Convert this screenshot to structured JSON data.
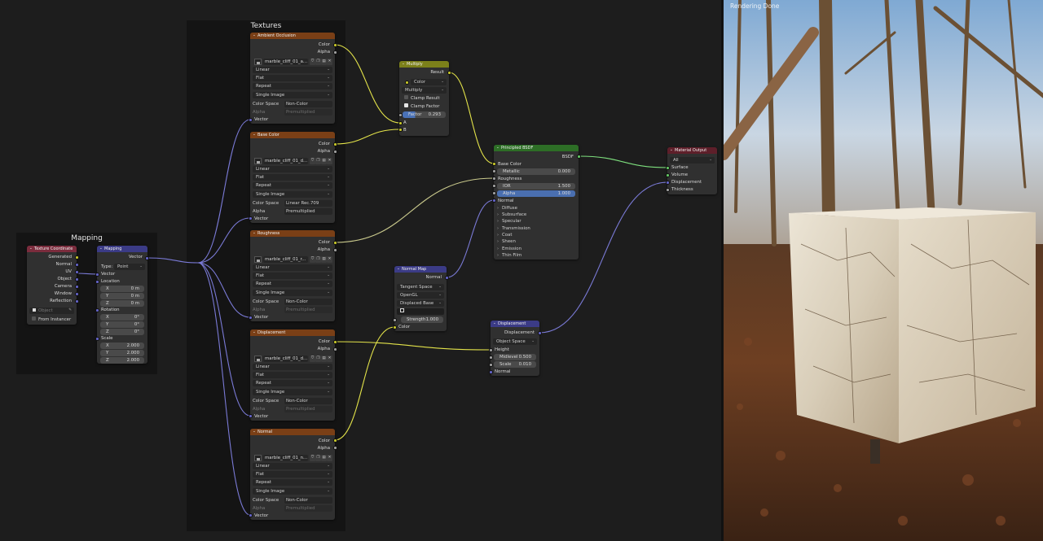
{
  "frames": {
    "textures": "Textures",
    "mapping": "Mapping"
  },
  "tex_coord": {
    "title": "Texture Coordinate",
    "outputs": [
      "Generated",
      "Normal",
      "UV",
      "Object",
      "Camera",
      "Window",
      "Reflection"
    ],
    "object_placeholder": "Object",
    "from_instancer": "From Instancer"
  },
  "mapping": {
    "title": "Mapping",
    "output": "Vector",
    "type_label": "Type:",
    "type_value": "Point",
    "vector": "Vector",
    "location": {
      "label": "Location",
      "x": "0 m",
      "y": "0 m",
      "z": "0 m"
    },
    "rotation": {
      "label": "Rotation",
      "x": "0°",
      "y": "0°",
      "z": "0°"
    },
    "scale": {
      "label": "Scale",
      "x": "2.000",
      "y": "2.000",
      "z": "2.000"
    },
    "axes": [
      "X",
      "Y",
      "Z"
    ]
  },
  "textures": [
    {
      "title": "Ambient Occlusion",
      "file": "marble_cliff_01_a...",
      "interp": "Linear",
      "proj": "Flat",
      "ext": "Repeat",
      "source": "Single Image",
      "cs_label": "Color Space",
      "cs_value": "Non-Color",
      "alpha_label": "Alpha",
      "alpha_value": "Premultiplied",
      "alpha_dim": true
    },
    {
      "title": "Base Color",
      "file": "marble_cliff_01_d...",
      "interp": "Linear",
      "proj": "Flat",
      "ext": "Repeat",
      "source": "Single Image",
      "cs_label": "Color Space",
      "cs_value": "Linear Rec.709",
      "alpha_label": "Alpha",
      "alpha_value": "Premultiplied",
      "alpha_dim": false
    },
    {
      "title": "Roughness",
      "file": "marble_cliff_01_r...",
      "interp": "Linear",
      "proj": "Flat",
      "ext": "Repeat",
      "source": "Single Image",
      "cs_label": "Color Space",
      "cs_value": "Non-Color",
      "alpha_label": "Alpha",
      "alpha_value": "Premultiplied",
      "alpha_dim": true
    },
    {
      "title": "Displacement",
      "file": "marble_cliff_01_d...",
      "interp": "Linear",
      "proj": "Flat",
      "ext": "Repeat",
      "source": "Single Image",
      "cs_label": "Color Space",
      "cs_value": "Non-Color",
      "alpha_label": "Alpha",
      "alpha_value": "Premultiplied",
      "alpha_dim": true
    },
    {
      "title": "Normal",
      "file": "marble_cliff_01_n...",
      "interp": "Linear",
      "proj": "Flat",
      "ext": "Repeat",
      "source": "Single Image",
      "cs_label": "Color Space",
      "cs_value": "Non-Color",
      "alpha_label": "Alpha",
      "alpha_value": "Premultiplied",
      "alpha_dim": true
    }
  ],
  "tex_sockets": {
    "color": "Color",
    "alpha": "Alpha",
    "vector": "Vector"
  },
  "multiply": {
    "title": "Multiply",
    "result": "Result",
    "data_type": "Color",
    "blend": "Multiply",
    "clamp_result": "Clamp Result",
    "clamp_factor": "Clamp Factor",
    "clamp_result_on": false,
    "clamp_factor_on": true,
    "factor_label": "Factor",
    "factor_value": "0.293",
    "a": "A",
    "b": "B"
  },
  "bsdf": {
    "title": "Principled BSDF",
    "output": "BSDF",
    "base_color": "Base Color",
    "metallic_label": "Metallic",
    "metallic_value": "0.000",
    "roughness": "Roughness",
    "ior_label": "IOR",
    "ior_value": "1.500",
    "alpha_label": "Alpha",
    "alpha_value": "1.000",
    "normal": "Normal",
    "panels": [
      "Diffuse",
      "Subsurface",
      "Specular",
      "Transmission",
      "Coat",
      "Sheen",
      "Emission",
      "Thin Film"
    ]
  },
  "material_output": {
    "title": "Material Output",
    "target": "All",
    "inputs": [
      "Surface",
      "Volume",
      "Displacement",
      "Thickness"
    ]
  },
  "normal_map": {
    "title": "Normal Map",
    "output": "Normal",
    "space": "Tangent Space",
    "convention": "OpenGL",
    "base": "Displaced Base",
    "strength_label": "Strength",
    "strength_value": "1.000",
    "color": "Color"
  },
  "displacement": {
    "title": "Displacement",
    "output": "Displacement",
    "space": "Object Space",
    "height": "Height",
    "midlevel_label": "Midlevel",
    "midlevel_value": "0.500",
    "scale_label": "Scale",
    "scale_value": "0.010",
    "normal": "Normal"
  },
  "viewport": {
    "status": "Rendering Done"
  },
  "colors": {
    "socket_color": "#c7c729",
    "socket_float": "#a1a1a1",
    "socket_vector": "#6363c7",
    "socket_shader": "#63c763",
    "header_texture": "#7a3f16",
    "header_vector": "#3b3b86",
    "header_converter": "#7c801a",
    "header_shader": "#2d6e26",
    "header_output": "#5e1f2a",
    "header_input": "#7b2c3d"
  }
}
